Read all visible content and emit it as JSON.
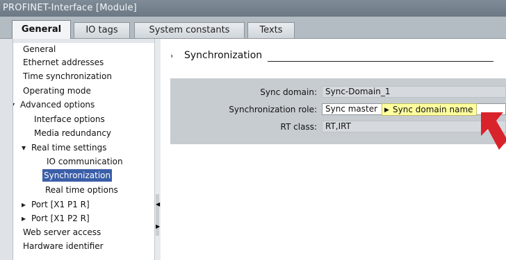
{
  "window": {
    "title": "PROFINET-Interface [Module]"
  },
  "tabs": [
    {
      "label": "General",
      "active": true
    },
    {
      "label": "IO tags",
      "active": false
    },
    {
      "label": "System constants",
      "active": false
    },
    {
      "label": "Texts",
      "active": false
    }
  ],
  "nav": {
    "items": [
      {
        "label": "General"
      },
      {
        "label": "Ethernet addresses"
      },
      {
        "label": "Time synchronization"
      },
      {
        "label": "Operating mode"
      },
      {
        "label": "Advanced options"
      },
      {
        "label": "Interface options"
      },
      {
        "label": "Media redundancy"
      },
      {
        "label": "Real time settings"
      },
      {
        "label": "IO communication"
      },
      {
        "label": "Synchronization"
      },
      {
        "label": "Real time options"
      },
      {
        "label": "Port [X1 P1 R]"
      },
      {
        "label": "Port [X1 P2 R]"
      },
      {
        "label": "Web server access"
      },
      {
        "label": "Hardware identifier"
      }
    ],
    "selected": "Synchronization"
  },
  "section": {
    "title": "Synchronization"
  },
  "fields": {
    "sync_domain": {
      "label": "Sync domain:",
      "value": "Sync-Domain_1"
    },
    "sync_role": {
      "label": "Synchronization role:",
      "value": "Sync master"
    },
    "rt_class": {
      "label": "RT class:",
      "value": "RT,IRT"
    }
  },
  "tooltip": {
    "text": "Sync domain name"
  },
  "colors": {
    "selection": "#3b5ea8",
    "tooltip_bg": "#ffff9e",
    "arrow": "#d9232a",
    "panel_grey": "#c7ccd1"
  }
}
